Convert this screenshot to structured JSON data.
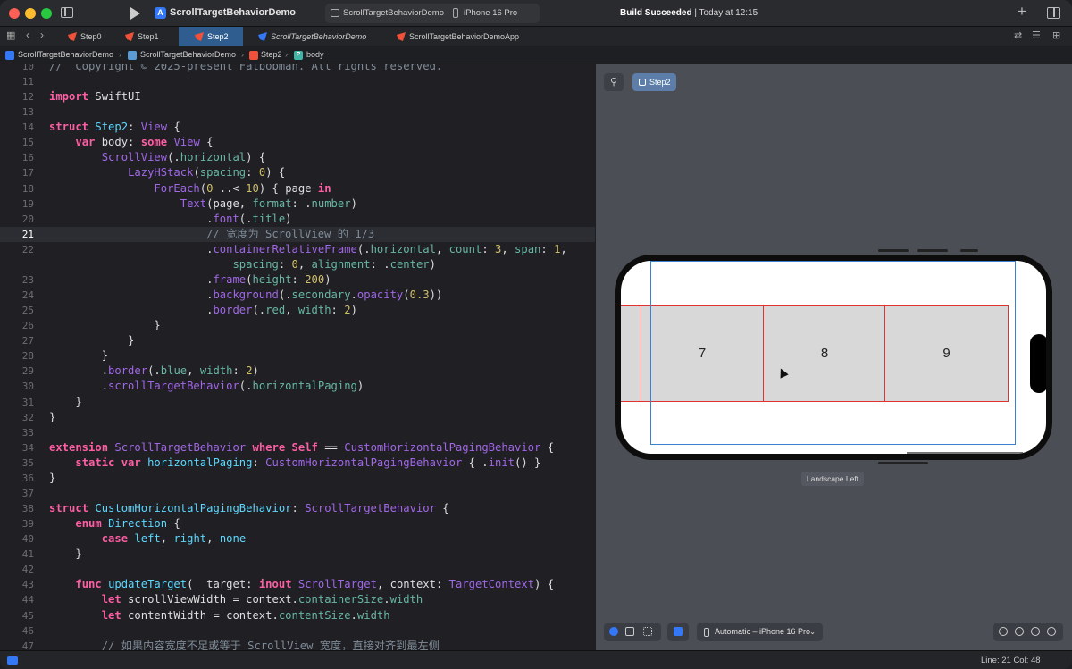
{
  "titlebar": {
    "project_name": "ScrollTargetBehaviorDemo",
    "scheme_project": "ScrollTargetBehaviorDemo",
    "scheme_device": "iPhone 16 Pro",
    "build_status_bold": "Build Succeeded",
    "build_status_time": " | Today at 12:15"
  },
  "tabs": [
    {
      "label": "Step0"
    },
    {
      "label": "Step1"
    },
    {
      "label": "Step2"
    },
    {
      "label": "ScrollTargetBehaviorDemo"
    },
    {
      "label": "ScrollTargetBehaviorDemoApp"
    }
  ],
  "breadcrumb": {
    "project": "ScrollTargetBehaviorDemo",
    "folder": "ScrollTargetBehaviorDemo",
    "file": "Step2",
    "symbol": "body"
  },
  "editor": {
    "lines": [
      {
        "n": "10",
        "code": [
          [
            "cm",
            "//  Copyright © 2025-present Fatbobman. All rights reserved."
          ]
        ]
      },
      {
        "n": "11",
        "code": []
      },
      {
        "n": "12",
        "code": [
          [
            "kw",
            "import"
          ],
          [
            "pl",
            " SwiftUI"
          ]
        ]
      },
      {
        "n": "13",
        "code": []
      },
      {
        "n": "14",
        "code": [
          [
            "kw",
            "struct"
          ],
          [
            "pl",
            " "
          ],
          [
            "ty",
            "Step2"
          ],
          [
            "pl",
            ": "
          ],
          [
            "pr",
            "View"
          ],
          [
            "pl",
            " {"
          ]
        ]
      },
      {
        "n": "15",
        "code": [
          [
            "pl",
            "    "
          ],
          [
            "kw",
            "var"
          ],
          [
            "pl",
            " body: "
          ],
          [
            "kw",
            "some"
          ],
          [
            "pl",
            " "
          ],
          [
            "pr",
            "View"
          ],
          [
            "pl",
            " {"
          ]
        ]
      },
      {
        "n": "16",
        "code": [
          [
            "pl",
            "        "
          ],
          [
            "pr",
            "ScrollView"
          ],
          [
            "pl",
            "(."
          ],
          [
            "fn",
            "horizontal"
          ],
          [
            "pl",
            ") {"
          ]
        ]
      },
      {
        "n": "17",
        "code": [
          [
            "pl",
            "            "
          ],
          [
            "pr",
            "LazyHStack"
          ],
          [
            "pl",
            "("
          ],
          [
            "fn",
            "spacing"
          ],
          [
            "pl",
            ": "
          ],
          [
            "num",
            "0"
          ],
          [
            "pl",
            ") {"
          ]
        ]
      },
      {
        "n": "18",
        "code": [
          [
            "pl",
            "                "
          ],
          [
            "pr",
            "ForEach"
          ],
          [
            "pl",
            "("
          ],
          [
            "num",
            "0"
          ],
          [
            "pl",
            " ..< "
          ],
          [
            "num",
            "10"
          ],
          [
            "pl",
            ") { page "
          ],
          [
            "kw",
            "in"
          ]
        ]
      },
      {
        "n": "19",
        "code": [
          [
            "pl",
            "                    "
          ],
          [
            "pr",
            "Text"
          ],
          [
            "pl",
            "(page, "
          ],
          [
            "fn",
            "format"
          ],
          [
            "pl",
            ": ."
          ],
          [
            "fn",
            "number"
          ],
          [
            "pl",
            ")"
          ]
        ]
      },
      {
        "n": "20",
        "code": [
          [
            "pl",
            "                        ."
          ],
          [
            "pr",
            "font"
          ],
          [
            "pl",
            "(."
          ],
          [
            "fn",
            "title"
          ],
          [
            "pl",
            ")"
          ]
        ]
      },
      {
        "n": "21",
        "code": [
          [
            "cm",
            "                        // 宽度为 ScrollView 的 1/3"
          ]
        ]
      },
      {
        "n": "22",
        "code": [
          [
            "pl",
            "                        ."
          ],
          [
            "pr",
            "containerRelativeFrame"
          ],
          [
            "pl",
            "(."
          ],
          [
            "fn",
            "horizontal"
          ],
          [
            "pl",
            ", "
          ],
          [
            "fn",
            "count"
          ],
          [
            "pl",
            ": "
          ],
          [
            "num",
            "3"
          ],
          [
            "pl",
            ", "
          ],
          [
            "fn",
            "span"
          ],
          [
            "pl",
            ": "
          ],
          [
            "num",
            "1"
          ],
          [
            "pl",
            ","
          ]
        ]
      },
      {
        "n": "",
        "code": [
          [
            "pl",
            "                            "
          ],
          [
            "fn",
            "spacing"
          ],
          [
            "pl",
            ": "
          ],
          [
            "num",
            "0"
          ],
          [
            "pl",
            ", "
          ],
          [
            "fn",
            "alignment"
          ],
          [
            "pl",
            ": ."
          ],
          [
            "fn",
            "center"
          ],
          [
            "pl",
            ")"
          ]
        ]
      },
      {
        "n": "23",
        "code": [
          [
            "pl",
            "                        ."
          ],
          [
            "pr",
            "frame"
          ],
          [
            "pl",
            "("
          ],
          [
            "fn",
            "height"
          ],
          [
            "pl",
            ": "
          ],
          [
            "num",
            "200"
          ],
          [
            "pl",
            ")"
          ]
        ]
      },
      {
        "n": "24",
        "code": [
          [
            "pl",
            "                        ."
          ],
          [
            "pr",
            "background"
          ],
          [
            "pl",
            "(."
          ],
          [
            "fn",
            "secondary"
          ],
          [
            "pl",
            "."
          ],
          [
            "pr",
            "opacity"
          ],
          [
            "pl",
            "("
          ],
          [
            "num",
            "0.3"
          ],
          [
            "pl",
            "))"
          ]
        ]
      },
      {
        "n": "25",
        "code": [
          [
            "pl",
            "                        ."
          ],
          [
            "pr",
            "border"
          ],
          [
            "pl",
            "(."
          ],
          [
            "fn",
            "red"
          ],
          [
            "pl",
            ", "
          ],
          [
            "fn",
            "width"
          ],
          [
            "pl",
            ": "
          ],
          [
            "num",
            "2"
          ],
          [
            "pl",
            ")"
          ]
        ]
      },
      {
        "n": "26",
        "code": [
          [
            "pl",
            "                }"
          ]
        ]
      },
      {
        "n": "27",
        "code": [
          [
            "pl",
            "            }"
          ]
        ]
      },
      {
        "n": "28",
        "code": [
          [
            "pl",
            "        }"
          ]
        ]
      },
      {
        "n": "29",
        "code": [
          [
            "pl",
            "        ."
          ],
          [
            "pr",
            "border"
          ],
          [
            "pl",
            "(."
          ],
          [
            "fn",
            "blue"
          ],
          [
            "pl",
            ", "
          ],
          [
            "fn",
            "width"
          ],
          [
            "pl",
            ": "
          ],
          [
            "num",
            "2"
          ],
          [
            "pl",
            ")"
          ]
        ]
      },
      {
        "n": "30",
        "code": [
          [
            "pl",
            "        ."
          ],
          [
            "pr",
            "scrollTargetBehavior"
          ],
          [
            "pl",
            "(."
          ],
          [
            "fn",
            "horizontalPaging"
          ],
          [
            "pl",
            ")"
          ]
        ]
      },
      {
        "n": "31",
        "code": [
          [
            "pl",
            "    }"
          ]
        ]
      },
      {
        "n": "32",
        "code": [
          [
            "pl",
            "}"
          ]
        ]
      },
      {
        "n": "33",
        "code": []
      },
      {
        "n": "34",
        "code": [
          [
            "kw",
            "extension"
          ],
          [
            "pl",
            " "
          ],
          [
            "pr",
            "ScrollTargetBehavior"
          ],
          [
            "pl",
            " "
          ],
          [
            "kw",
            "where"
          ],
          [
            "pl",
            " "
          ],
          [
            "kw",
            "Self"
          ],
          [
            "pl",
            " == "
          ],
          [
            "pr",
            "CustomHorizontalPagingBehavior"
          ],
          [
            "pl",
            " {"
          ]
        ]
      },
      {
        "n": "35",
        "code": [
          [
            "pl",
            "    "
          ],
          [
            "kw",
            "static var"
          ],
          [
            "pl",
            " "
          ],
          [
            "ty",
            "horizontalPaging"
          ],
          [
            "pl",
            ": "
          ],
          [
            "pr",
            "CustomHorizontalPagingBehavior"
          ],
          [
            "pl",
            " { ."
          ],
          [
            "pr",
            "init"
          ],
          [
            "pl",
            "() }"
          ]
        ]
      },
      {
        "n": "36",
        "code": [
          [
            "pl",
            "}"
          ]
        ]
      },
      {
        "n": "37",
        "code": []
      },
      {
        "n": "38",
        "code": [
          [
            "kw",
            "struct"
          ],
          [
            "pl",
            " "
          ],
          [
            "ty",
            "CustomHorizontalPagingBehavior"
          ],
          [
            "pl",
            ": "
          ],
          [
            "pr",
            "ScrollTargetBehavior"
          ],
          [
            "pl",
            " {"
          ]
        ]
      },
      {
        "n": "39",
        "code": [
          [
            "pl",
            "    "
          ],
          [
            "kw",
            "enum"
          ],
          [
            "pl",
            " "
          ],
          [
            "ty",
            "Direction"
          ],
          [
            "pl",
            " {"
          ]
        ]
      },
      {
        "n": "40",
        "code": [
          [
            "pl",
            "        "
          ],
          [
            "kw",
            "case"
          ],
          [
            "pl",
            " "
          ],
          [
            "ty",
            "left"
          ],
          [
            "pl",
            ", "
          ],
          [
            "ty",
            "right"
          ],
          [
            "pl",
            ", "
          ],
          [
            "ty",
            "none"
          ]
        ]
      },
      {
        "n": "41",
        "code": [
          [
            "pl",
            "    }"
          ]
        ]
      },
      {
        "n": "42",
        "code": []
      },
      {
        "n": "43",
        "code": [
          [
            "pl",
            "    "
          ],
          [
            "kw",
            "func"
          ],
          [
            "pl",
            " "
          ],
          [
            "ty",
            "updateTarget"
          ],
          [
            "pl",
            "(_ target: "
          ],
          [
            "kw",
            "inout"
          ],
          [
            "pl",
            " "
          ],
          [
            "pr",
            "ScrollTarget"
          ],
          [
            "pl",
            ", context: "
          ],
          [
            "pr",
            "TargetContext"
          ],
          [
            "pl",
            ") {"
          ]
        ]
      },
      {
        "n": "44",
        "code": [
          [
            "pl",
            "        "
          ],
          [
            "kw",
            "let"
          ],
          [
            "pl",
            " scrollViewWidth = context."
          ],
          [
            "fn",
            "containerSize"
          ],
          [
            "pl",
            "."
          ],
          [
            "fn",
            "width"
          ]
        ]
      },
      {
        "n": "45",
        "code": [
          [
            "pl",
            "        "
          ],
          [
            "kw",
            "let"
          ],
          [
            "pl",
            " contentWidth = context."
          ],
          [
            "fn",
            "contentSize"
          ],
          [
            "pl",
            "."
          ],
          [
            "fn",
            "width"
          ]
        ]
      },
      {
        "n": "46",
        "code": []
      },
      {
        "n": "47",
        "code": [
          [
            "cm",
            "        // 如果内容宽度不足或等于 ScrollView 宽度，直接对齐到最左侧"
          ]
        ]
      }
    ]
  },
  "preview": {
    "tab_label": "Step2",
    "pages": [
      {
        "label": ""
      },
      {
        "label": "7"
      },
      {
        "label": "8"
      },
      {
        "label": "9"
      }
    ],
    "orientation_label": "Landscape Left",
    "device_selector": "Automatic – iPhone 16 Pro"
  },
  "status": {
    "position": "Line: 21  Col: 48"
  },
  "colors": {
    "accent": "#3478f6",
    "active_tab": "#2f5d8f",
    "page_border": "#dd3333",
    "scroll_border": "#3a7fd0"
  }
}
